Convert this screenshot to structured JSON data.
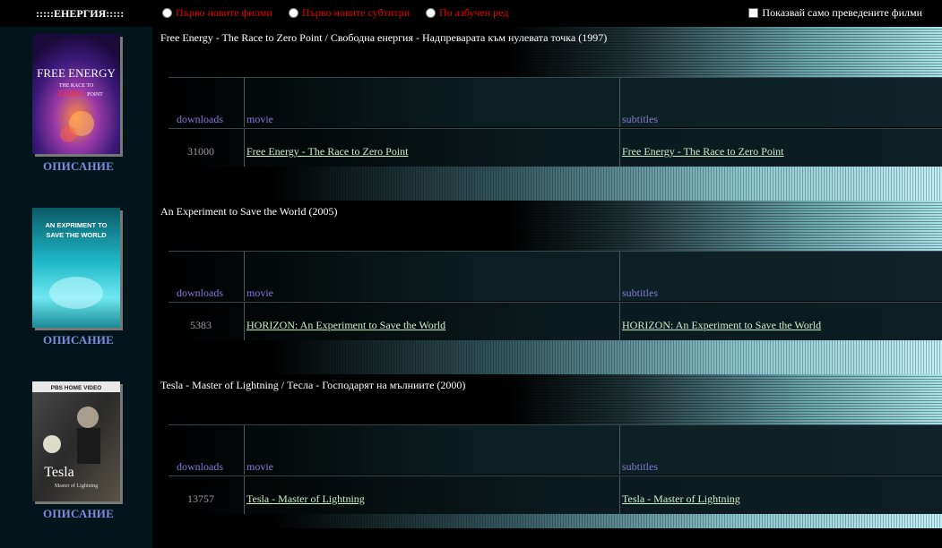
{
  "header": {
    "category_title": ":::::ЕНЕРГИЯ:::::",
    "sort_options": [
      "Първо новите филми",
      "Първо новите субтитри",
      "По азбучен ред"
    ],
    "filter_label": "Показвай само преведените филми"
  },
  "colors": {
    "sort_text": "#e00000",
    "description_link": "#7c8ce0",
    "column_header": "#8878d8",
    "link_text": "#c8f0c8",
    "download_count": "#9a9a9a"
  },
  "entries": [
    {
      "title": "Free Energy - The Race to Zero Point / Свободна енергия - Надпреварата към нулевата точка (1997)",
      "description_label": "ОПИСАНИЕ",
      "columns": {
        "downloads": "downloads",
        "movie": "movie",
        "subtitles": "subtitles"
      },
      "downloads": "31000",
      "movie_link": "Free Energy - The Race to Zero Point",
      "subtitles_link": "Free Energy - The Race to Zero Point",
      "cover": {
        "line1": "FREE ENERGY",
        "line2": "THE RACE TO",
        "line3": "ZERO",
        "line4": "POINT"
      }
    },
    {
      "title": "An Experiment to Save the World (2005)",
      "description_label": "ОПИСАНИЕ",
      "columns": {
        "downloads": "downloads",
        "movie": "movie",
        "subtitles": "subtitles"
      },
      "downloads": "5383",
      "movie_link": "HORIZON: An Experiment to Save the World",
      "subtitles_link": "HORIZON: An Experiment to Save the World",
      "cover": {
        "line1": "AN EXPRIMENT TO",
        "line2": "SAVE THE WORLD"
      }
    },
    {
      "title": "Tesla - Master of Lightning / Тесла - Господарят на мълниите (2000)",
      "description_label": "ОПИСАНИЕ",
      "columns": {
        "downloads": "downloads",
        "movie": "movie",
        "subtitles": "subtitles"
      },
      "downloads": "13757",
      "movie_link": "Tesla - Master of Lightning",
      "subtitles_link": "Tesla - Master of Lightning",
      "cover": {
        "line1": "PBS HOME VIDEO",
        "line2": "Tesla",
        "line3": "Master of Lightning"
      }
    }
  ]
}
